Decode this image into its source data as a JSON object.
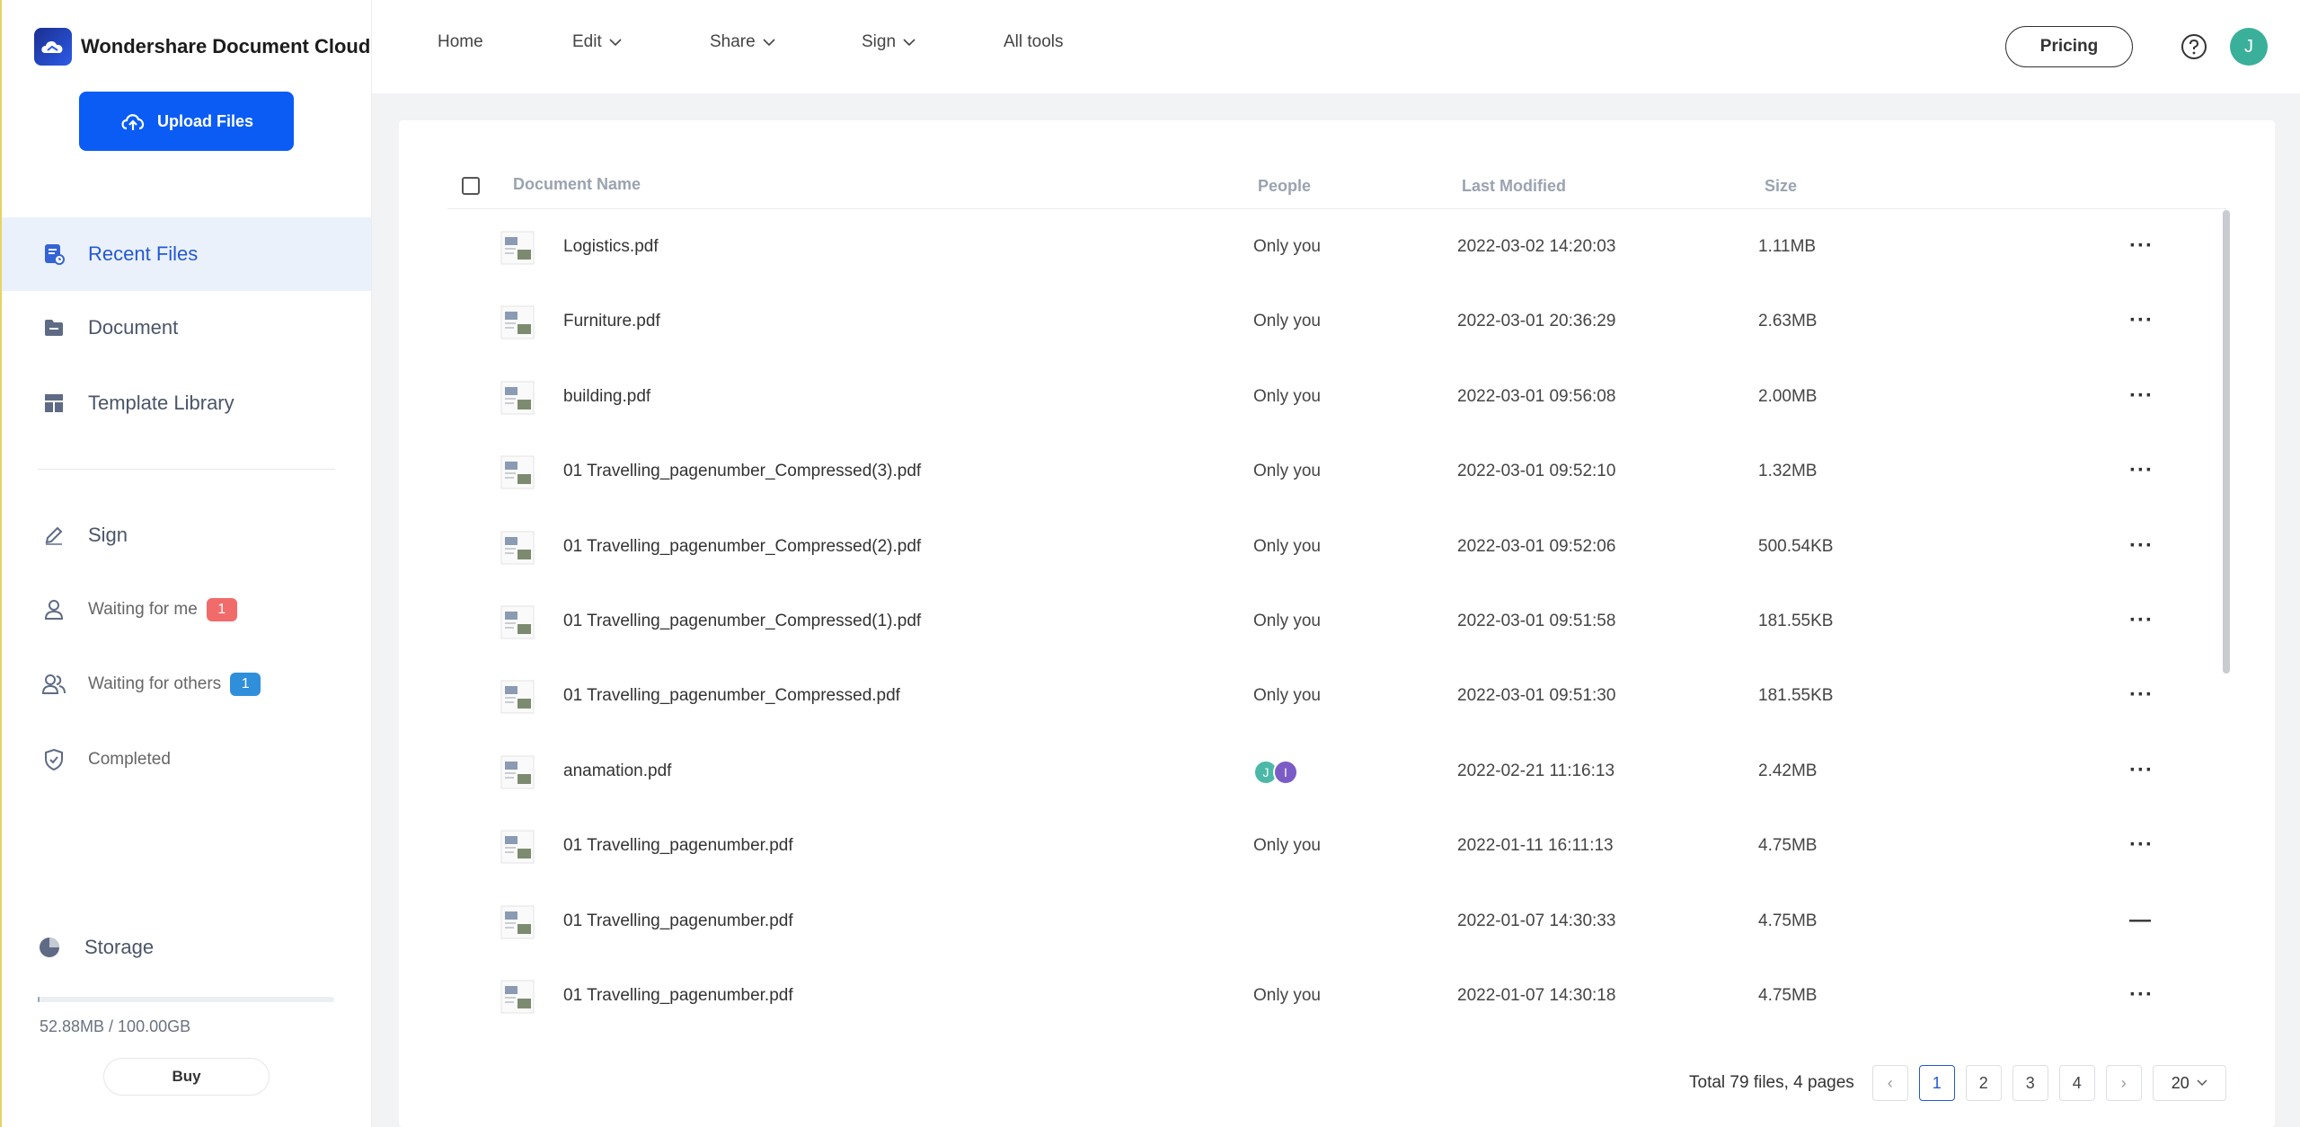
{
  "app": {
    "brand_name": "Wondershare Document Cloud",
    "upload_label": "Upload Files"
  },
  "sidebar": {
    "nav": [
      {
        "label": "Recent Files",
        "icon": "recent-files-icon",
        "active": true
      },
      {
        "label": "Document",
        "icon": "folder-icon",
        "active": false
      },
      {
        "label": "Template Library",
        "icon": "template-icon",
        "active": false
      }
    ],
    "sign": {
      "label": "Sign",
      "waiting_me": {
        "label": "Waiting for me",
        "count": "1"
      },
      "waiting_others": {
        "label": "Waiting for others",
        "count": "1"
      },
      "completed": "Completed"
    },
    "storage": {
      "label": "Storage",
      "used_text": "52.88MB / 100.00GB",
      "fraction": 0.0005,
      "buy_label": "Buy"
    }
  },
  "topbar": {
    "home": "Home",
    "edit": "Edit",
    "share": "Share",
    "sign": "Sign",
    "all_tools": "All tools",
    "pricing": "Pricing",
    "avatar_letter": "J"
  },
  "table": {
    "headers": {
      "name": "Document Name",
      "people": "People",
      "modified": "Last Modified",
      "size": "Size"
    },
    "rows": [
      {
        "name": "Logistics.pdf",
        "people": "Only you",
        "date": "2022-03-02 14:20:03",
        "size": "1.11MB",
        "action": "···"
      },
      {
        "name": "Furniture.pdf",
        "people": "Only you",
        "date": "2022-03-01 20:36:29",
        "size": "2.63MB",
        "action": "···"
      },
      {
        "name": "building.pdf",
        "people": "Only you",
        "date": "2022-03-01 09:56:08",
        "size": "2.00MB",
        "action": "···"
      },
      {
        "name": "01 Travelling_pagenumber_Compressed(3).pdf",
        "people": "Only you",
        "date": "2022-03-01 09:52:10",
        "size": "1.32MB",
        "action": "···"
      },
      {
        "name": "01 Travelling_pagenumber_Compressed(2).pdf",
        "people": "Only you",
        "date": "2022-03-01 09:52:06",
        "size": "500.54KB",
        "action": "···"
      },
      {
        "name": "01 Travelling_pagenumber_Compressed(1).pdf",
        "people": "Only you",
        "date": "2022-03-01 09:51:58",
        "size": "181.55KB",
        "action": "···"
      },
      {
        "name": "01 Travelling_pagenumber_Compressed.pdf",
        "people": "Only you",
        "date": "2022-03-01 09:51:30",
        "size": "181.55KB",
        "action": "···"
      },
      {
        "name": "anamation.pdf",
        "people": "",
        "avatars": [
          "J",
          "I"
        ],
        "date": "2022-02-21 11:16:13",
        "size": "2.42MB",
        "action": "···"
      },
      {
        "name": "01 Travelling_pagenumber.pdf",
        "people": "Only you",
        "date": "2022-01-11 16:11:13",
        "size": "4.75MB",
        "action": "···"
      },
      {
        "name": "01 Travelling_pagenumber.pdf",
        "people": "",
        "date": "2022-01-07 14:30:33",
        "size": "4.75MB",
        "action": "—"
      },
      {
        "name": "01 Travelling_pagenumber.pdf",
        "people": "Only you",
        "date": "2022-01-07 14:30:18",
        "size": "4.75MB",
        "action": "···"
      }
    ]
  },
  "pagination": {
    "summary": "Total 79 files, 4 pages",
    "prev": "‹",
    "next": "›",
    "pages": [
      "1",
      "2",
      "3",
      "4"
    ],
    "current": "1",
    "page_size": "20"
  },
  "colors": {
    "accent": "#0a5cf5",
    "active_nav_bg": "#ebf1fb",
    "badge_red": "#f26b6b",
    "badge_blue": "#2f8fdb"
  }
}
